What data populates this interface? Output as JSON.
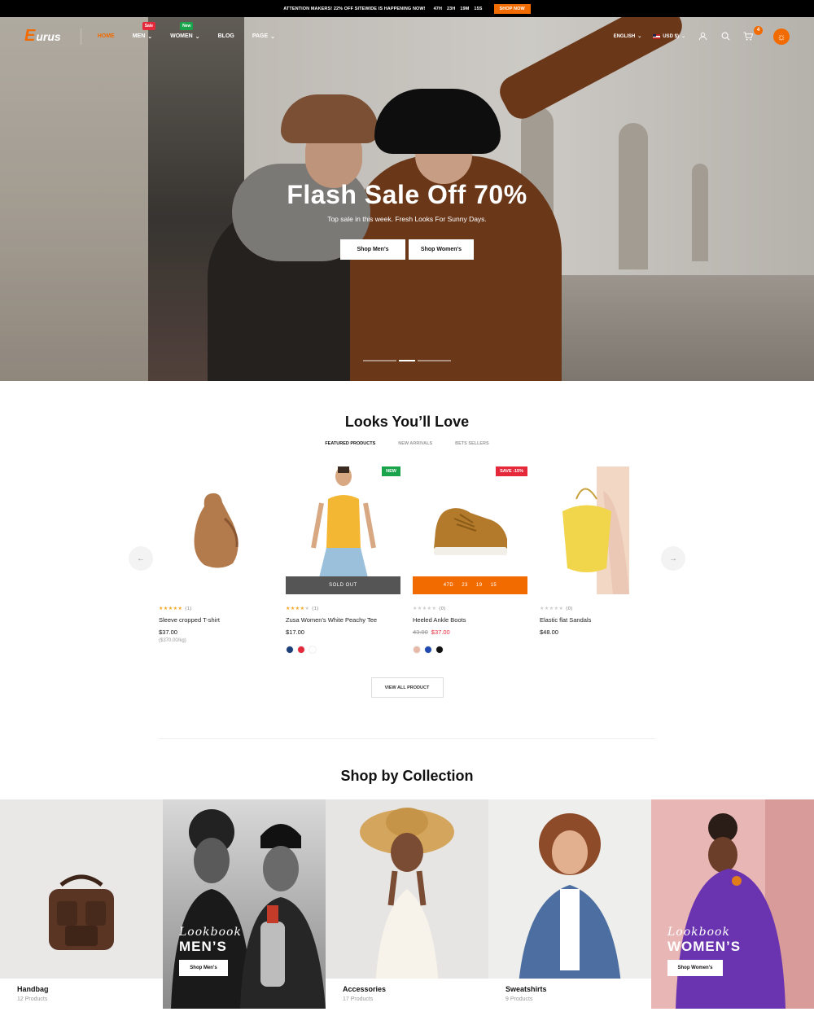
{
  "announcement": {
    "text": "ATTENTION MAKERS! 22% OFF SITEWIDE IS HAPPENING NOW!",
    "countdown": [
      "47H",
      "23H",
      "19M",
      "15S"
    ],
    "cta": "SHOP NOW"
  },
  "header": {
    "logo_mark": "E",
    "logo_text": "urus",
    "menu": [
      {
        "label": "HOME",
        "active": true
      },
      {
        "label": "MEN",
        "badge": "Sale",
        "dropdown": true
      },
      {
        "label": "WOMEN",
        "badge": "New",
        "dropdown": true
      },
      {
        "label": "BLOG"
      },
      {
        "label": "PAGE",
        "dropdown": true
      }
    ],
    "language": "ENGLISH",
    "currency": "USD $)",
    "cart_count": "4"
  },
  "hero": {
    "title": "Flash Sale Off 70%",
    "subtitle": "Top sale in this week. Fresh Looks For Sunny Days.",
    "btn_men": "Shop Men's",
    "btn_women": "Shop Women's"
  },
  "featured": {
    "title": "Looks You’ll Love",
    "tabs": [
      "FEATURED PRODUCTS",
      "NEW ARRIVALS",
      "BETS SELLERS"
    ],
    "products": [
      {
        "name": "Sleeve cropped T-shirt",
        "price": "$37.00",
        "unit": "($370.00/kg)",
        "rating": "(1)",
        "stars": 5
      },
      {
        "name": "Zusa Women's White Peachy Tee",
        "price": "$17.00",
        "rating": "(1)",
        "stars": 4,
        "tag": "NEW",
        "overlay": "SOLD OUT",
        "swatches": [
          "#1c3f7a",
          "#e5283a",
          "#ffffff"
        ]
      },
      {
        "name": "Heeled Ankle Boots",
        "old_price": "43.00",
        "price": "$37.00",
        "rating": "(0)",
        "stars": 0,
        "tag": "SAVE -15%",
        "countdown": [
          "47D",
          "23",
          "19",
          "15"
        ],
        "swatches": [
          "#e9b9a8",
          "#1f49b0",
          "#111111"
        ]
      },
      {
        "name": "Elastic flat Sandals",
        "price": "$48.00",
        "rating": "(0)",
        "stars": 0
      }
    ],
    "view_all": "VIEW ALL PRODUCT"
  },
  "collections": {
    "title": "Shop by Collection",
    "items": [
      {
        "title": "Handbag",
        "count": "12 Products"
      },
      {
        "lookbook": "Lookbook",
        "big": "MEN’S",
        "btn": "Shop Men's"
      },
      {
        "title": "Accessories",
        "count": "17 Products"
      },
      {
        "title": "Sweatshirts",
        "count": "9 Products"
      },
      {
        "lookbook": "Lookbook",
        "big": "WOMEN’S",
        "btn": "Shop Women's"
      }
    ]
  },
  "colors": {
    "accent": "#f26b00",
    "sale": "#e5283a",
    "new": "#19a34a"
  }
}
